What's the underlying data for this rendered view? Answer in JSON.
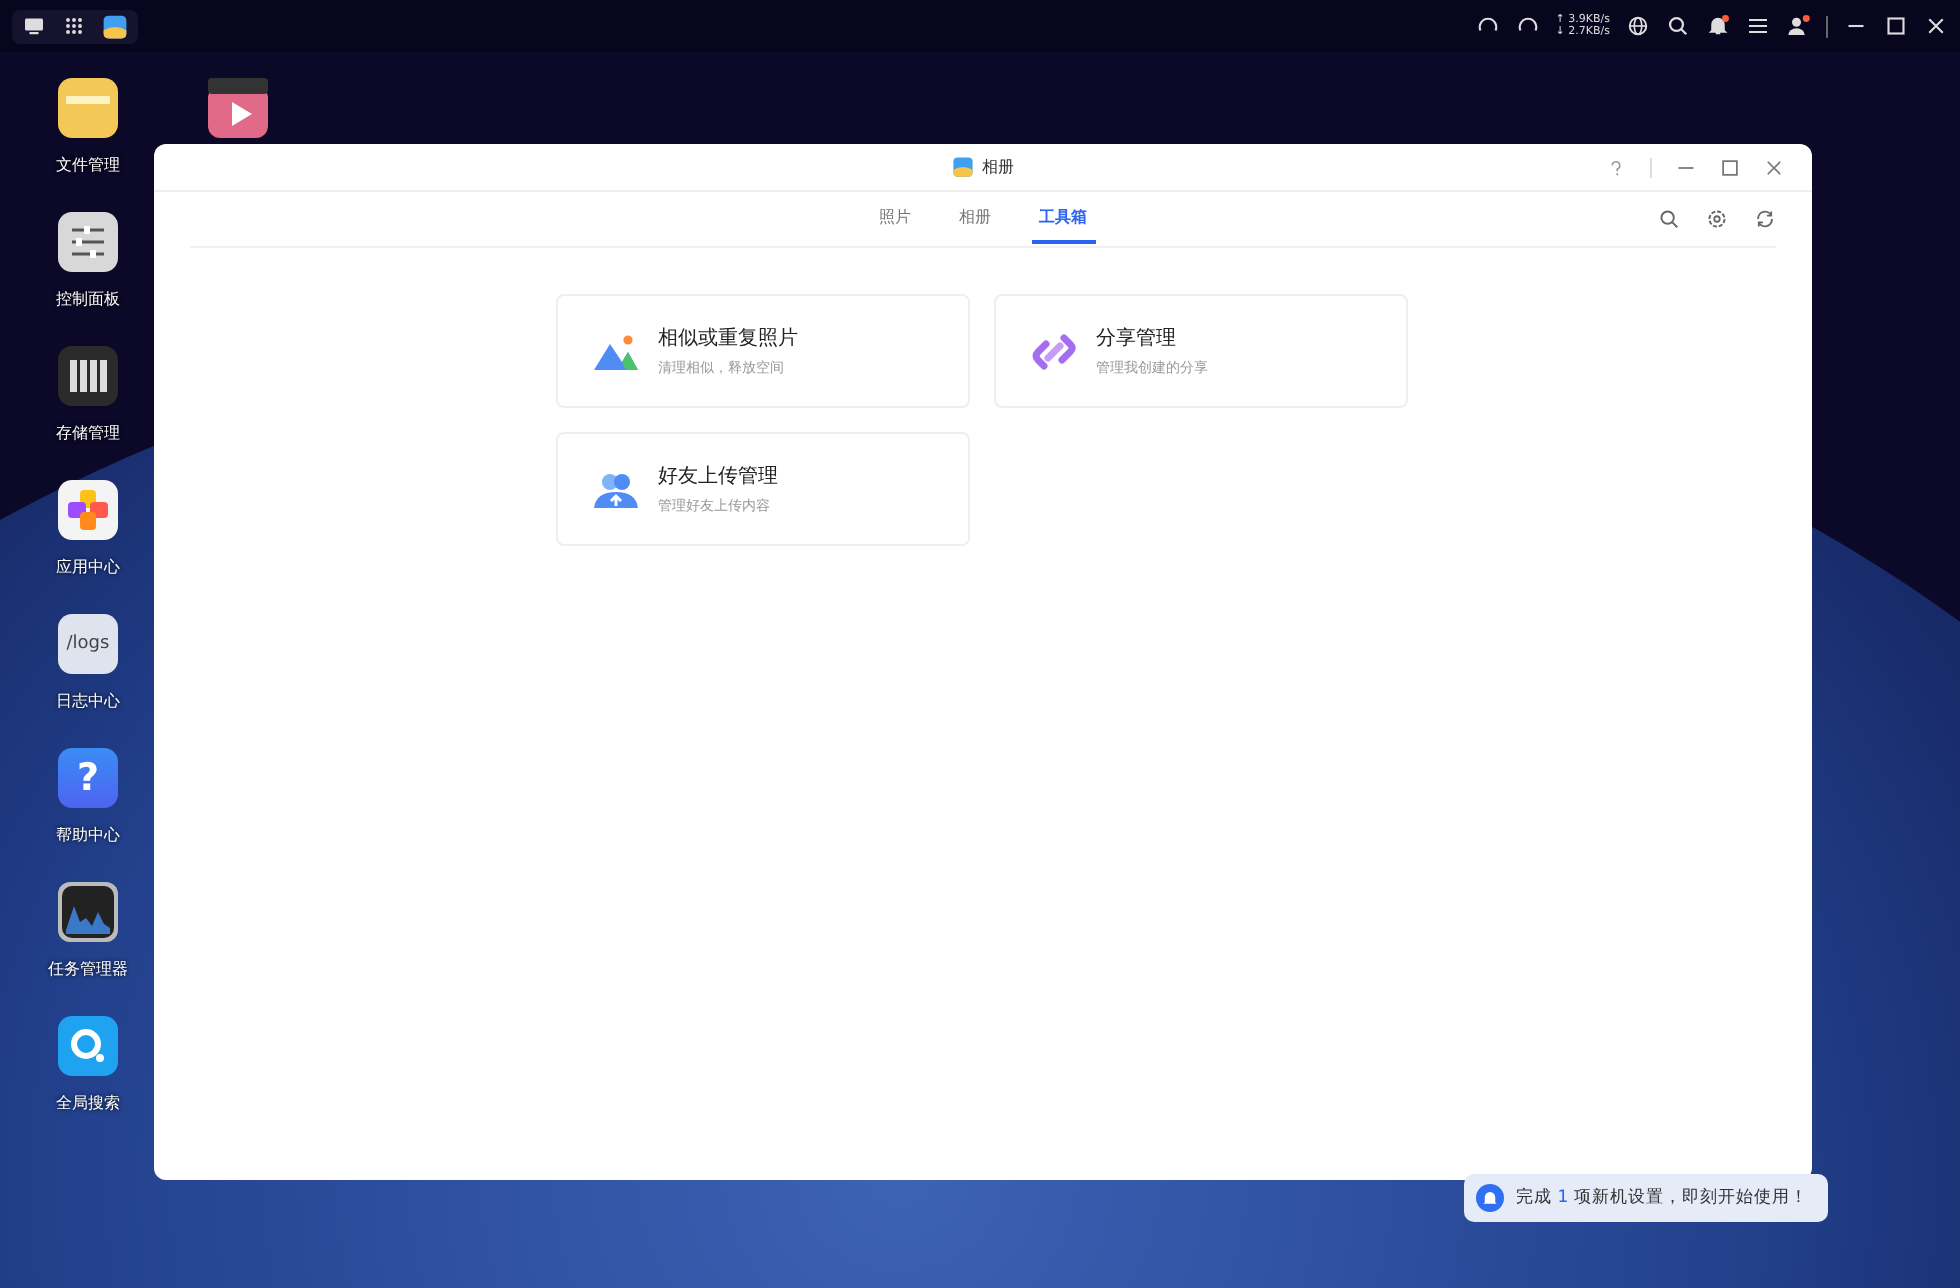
{
  "taskbar": {
    "upload": "↑ 3.9KB/s",
    "download": "↓ 2.7KB/s",
    "notifications_unread": true,
    "user_unread": true
  },
  "desktop_icons": [
    {
      "kind": "folder",
      "label": "文件管理"
    },
    {
      "kind": "sliders",
      "label": "控制面板"
    },
    {
      "kind": "storage",
      "label": "存储管理"
    },
    {
      "kind": "apps",
      "label": "应用中心"
    },
    {
      "kind": "logs",
      "label": "日志中心",
      "icon_text": "/logs"
    },
    {
      "kind": "help",
      "label": "帮助中心",
      "icon_text": "?"
    },
    {
      "kind": "monitor",
      "label": "任务管理器"
    },
    {
      "kind": "search",
      "label": "全局搜索"
    }
  ],
  "window": {
    "title": "相册",
    "tabs": [
      {
        "label": "照片",
        "selected": false
      },
      {
        "label": "相册",
        "selected": false
      },
      {
        "label": "工具箱",
        "selected": true
      }
    ],
    "cards": [
      {
        "kind": "photos",
        "title": "相似或重复照片",
        "subtitle": "清理相似，释放空间"
      },
      {
        "kind": "link",
        "title": "分享管理",
        "subtitle": "管理我创建的分享"
      },
      {
        "kind": "friends",
        "title": "好友上传管理",
        "subtitle": "管理好友上传内容"
      }
    ]
  },
  "notification": {
    "prefix": "完成",
    "count": "1",
    "suffix": "项新机设置，即刻开始使用！"
  }
}
